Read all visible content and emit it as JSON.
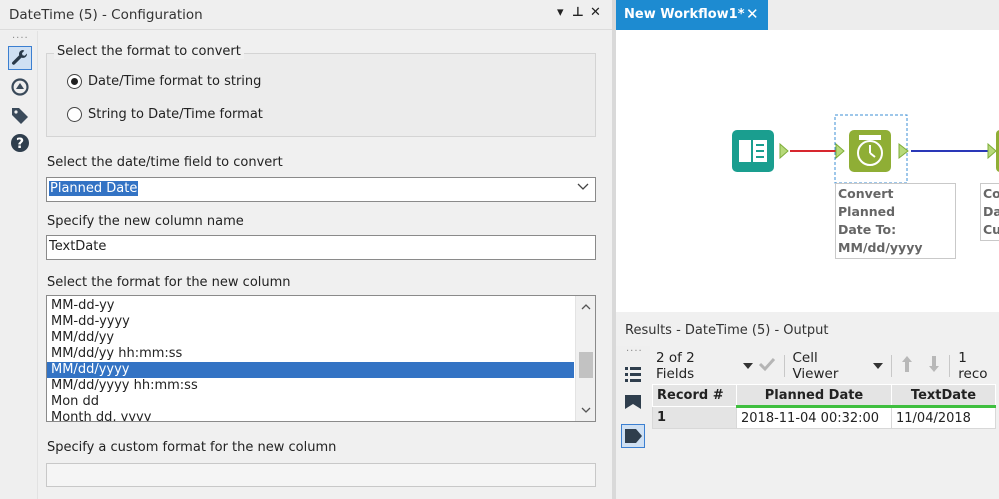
{
  "config": {
    "title": "DateTime (5) - Configuration",
    "controls": {
      "dropdown": "▾",
      "pin": "⊥",
      "close": "✕"
    },
    "grip": "····",
    "tools": [
      {
        "name": "wrench-icon",
        "active": true
      },
      {
        "name": "connection-icon",
        "active": false
      },
      {
        "name": "tag-icon",
        "active": false
      },
      {
        "name": "help-icon",
        "active": false
      }
    ],
    "format_group": {
      "legend": "Select the format to convert",
      "options": [
        {
          "label": "Date/Time format to string",
          "selected": true
        },
        {
          "label": "String to Date/Time format",
          "selected": false
        }
      ]
    },
    "field_select": {
      "label": "Select the date/time field to convert",
      "value": "Planned Date"
    },
    "new_column": {
      "label": "Specify the new column name",
      "value": "TextDate"
    },
    "format_list": {
      "label": "Select the format for the new column",
      "items": [
        "MM-dd-yy",
        "MM-dd-yyyy",
        "MM/dd/yy",
        "MM/dd/yy hh:mm:ss",
        "MM/dd/yyyy",
        "MM/dd/yyyy hh:mm:ss",
        "Mon dd",
        "Month dd, yyyy"
      ],
      "selected_index": 4
    },
    "custom_format": {
      "label": "Specify a custom format for the new column",
      "value": ""
    }
  },
  "workflow": {
    "tab_label": "New Workflow1*",
    "tab_close": "✕",
    "tool_label": [
      "Convert Planned",
      "Date To:",
      "MM/dd/yyyy"
    ],
    "next_label": [
      "Co",
      "Da",
      "Cu"
    ],
    "colors": {
      "input": "#1a9e8f",
      "datetime": "#8fae35",
      "accent": "#1d8bd1"
    }
  },
  "results": {
    "title": "Results - DateTime (5) - Output",
    "fields": "2 of 2 Fields",
    "viewer": "Cell Viewer",
    "records": "1 reco",
    "columns": [
      "Record #",
      "Planned Date",
      "TextDate"
    ],
    "rows": [
      {
        "record": "1",
        "planned_date": "2018-11-04 00:32:00",
        "text_date": "11/04/2018"
      }
    ]
  }
}
